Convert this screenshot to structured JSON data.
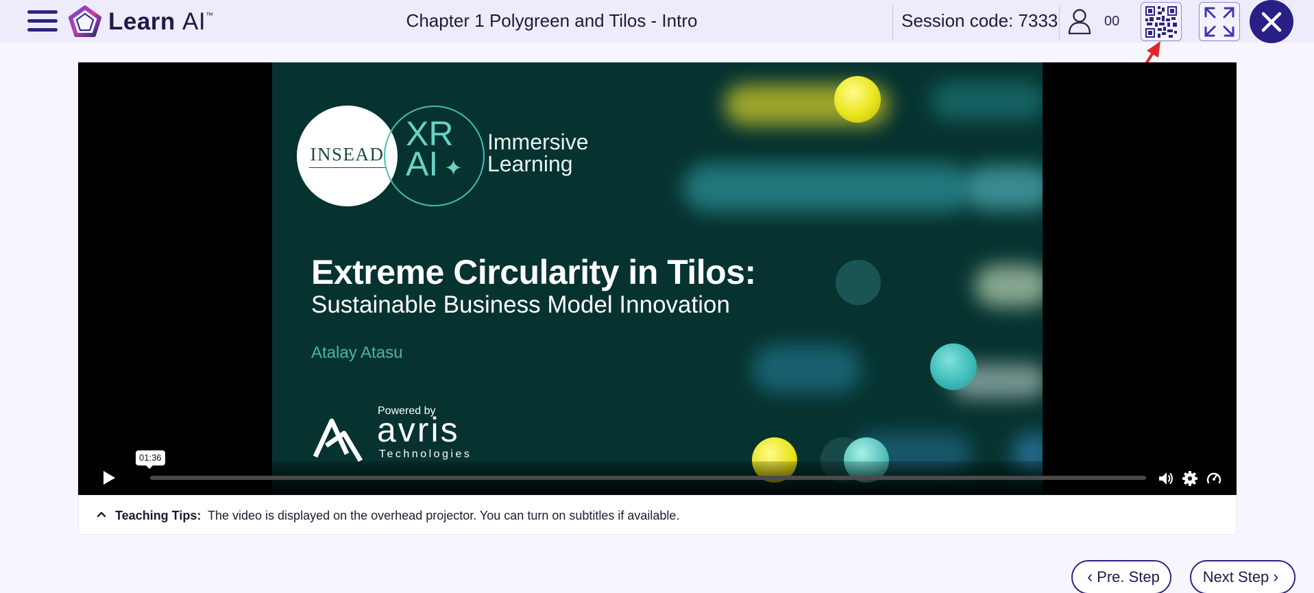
{
  "header": {
    "logo_word": "Learn",
    "logo_ai": "AI",
    "logo_tm": "™",
    "chapter_title": "Chapter 1 Polygreen and Tilos - Intro",
    "session_label": "Session code: 7333",
    "user_count": "00",
    "icons": [
      "hamburger-menu-icon",
      "user-icon",
      "qr-code-icon",
      "expand-icon",
      "close-icon"
    ],
    "accent_color": "#282084"
  },
  "video": {
    "slide": {
      "insead_logo": "INSEAD",
      "xr_logo_line1": "XR",
      "xr_logo_line2": "AI",
      "immersive_line1": "Immersive",
      "immersive_line2": "Learning",
      "title": "Extreme Circularity in Tilos:",
      "subtitle": "Sustainable Business Model Innovation",
      "author": "Atalay Atasu",
      "powered_by": "Powered by",
      "company": "avris",
      "company_sub": "Technologies"
    },
    "controls": {
      "time_tooltip": "01:36",
      "icons": [
        "play-icon",
        "volume-icon",
        "settings-icon",
        "speed-icon"
      ]
    }
  },
  "teaching_tips": {
    "label": "Teaching Tips:",
    "text": "The video is displayed on the overhead projector. You can turn on subtitles if available."
  },
  "navigation": {
    "prev_label": "Pre. Step",
    "next_label": "Next Step"
  }
}
